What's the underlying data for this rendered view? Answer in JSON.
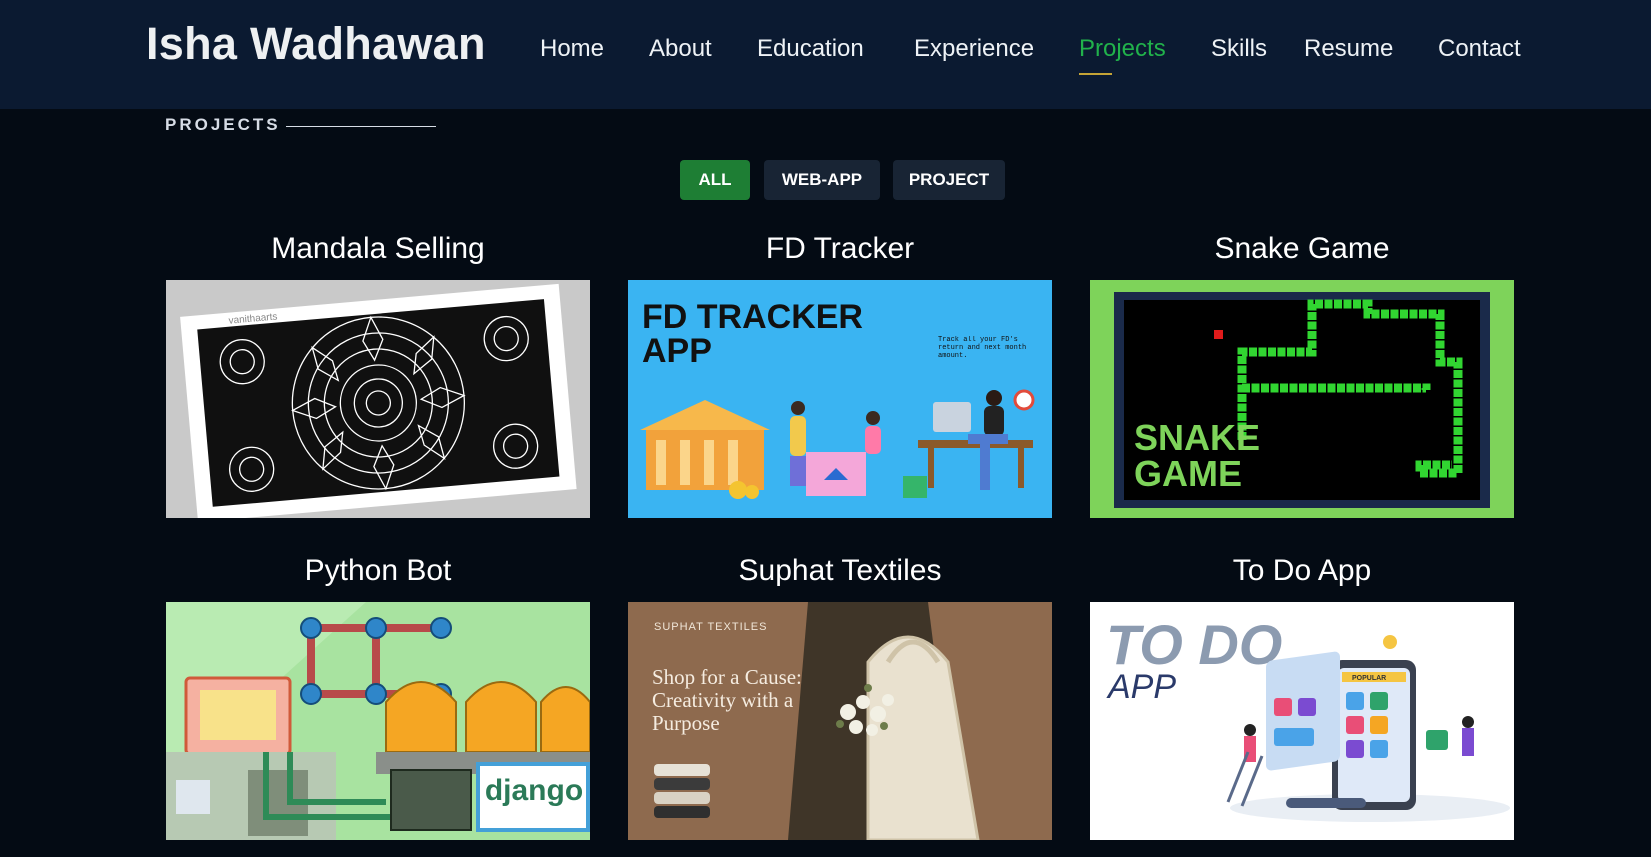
{
  "header": {
    "logo": "Isha Wadhawan",
    "nav": [
      "Home",
      "About",
      "Education",
      "Experience",
      "Projects",
      "Skills",
      "Resume",
      "Contact"
    ],
    "active_nav": "Projects",
    "active_color": "#21b24b"
  },
  "section": {
    "title": "PROJECTS"
  },
  "filters": [
    "ALL",
    "WEB-APP",
    "PROJECT"
  ],
  "active_filter": "ALL",
  "projects": [
    {
      "title": "Mandala Selling",
      "image_text": "vanithaarts"
    },
    {
      "title": "FD Tracker",
      "image_text": "FD TRACKER APP",
      "image_subtext": "Track all your FD's return and next month amount."
    },
    {
      "title": "Snake Game",
      "image_text": "SNAKE GAME"
    },
    {
      "title": "Python Bot",
      "image_text": "django"
    },
    {
      "title": "Suphat Textiles",
      "image_brand": "SUPHAT TEXTILES",
      "image_text": "Shop for a Cause: Creativity with a Purpose"
    },
    {
      "title": "To Do App",
      "image_text": "TO DO",
      "image_subtext": "APP",
      "image_badge": "POPULAR"
    }
  ]
}
